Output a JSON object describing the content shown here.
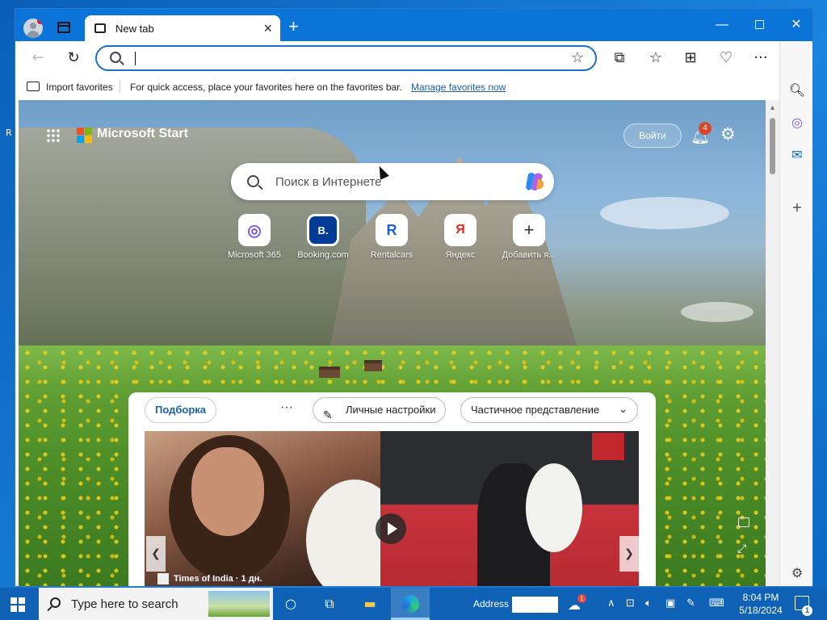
{
  "browser": {
    "tab_title": "New tab",
    "address_value": "",
    "favorites_bar": {
      "import_label": "Import favorites",
      "hint_text": "For quick access, place your favorites here on the favorites bar.",
      "manage_link": "Manage favorites now"
    }
  },
  "start_page": {
    "brand": "Microsoft Start",
    "login_label": "Войти",
    "notification_count": "4",
    "search_placeholder": "Поиск в Интернете",
    "quick_links": [
      {
        "label": "Microsoft 365",
        "tile": "◎",
        "color": "#7a5af5"
      },
      {
        "label": "Booking.com",
        "tile": "B.",
        "color": "#003b95"
      },
      {
        "label": "Rentalcars",
        "tile": "R",
        "color": "#1b62c9"
      },
      {
        "label": "Яндекс",
        "tile": "Я",
        "color": "#e02b1e"
      },
      {
        "label": "Добавить я...",
        "tile": "+",
        "color": "#333333"
      }
    ],
    "feed": {
      "tab_active": "Подборка",
      "more": "···",
      "personalize": "Личные настройки",
      "view_mode": "Частичное представление",
      "source": "Times of India · 1 дн."
    }
  },
  "taskbar": {
    "search_text": "Type here to search",
    "address_label": "Address",
    "weather_badge": "1",
    "time": "8:04 PM",
    "date": "5/18/2024",
    "notifications": "1"
  },
  "desktop": {
    "edge_glyph": "R"
  },
  "colors": {
    "accent": "#0b74d8",
    "taskbar": "#0e61b5",
    "link": "#1a5fb4"
  }
}
